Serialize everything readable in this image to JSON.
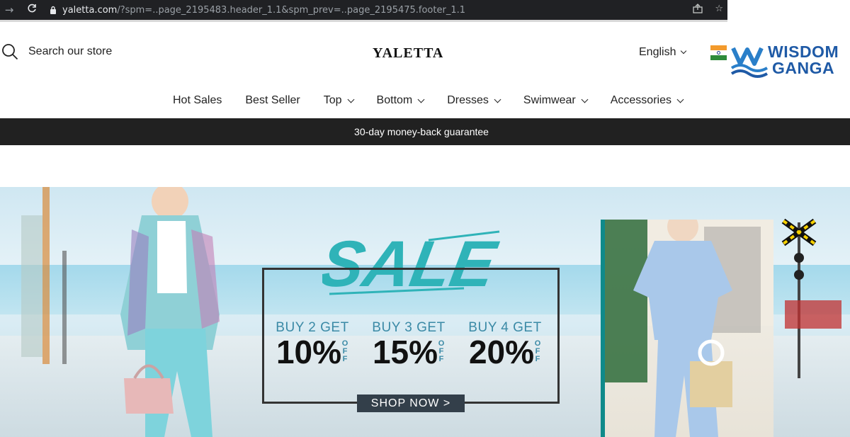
{
  "browser": {
    "url_host": "yaletta.com",
    "url_rest": "/?spm=..page_2195483.header_1.1&spm_prev=..page_2195475.footer_1.1"
  },
  "header": {
    "search_placeholder": "Search our store",
    "logo": "YALETTA",
    "language": "English"
  },
  "menu": [
    {
      "label": "Hot Sales",
      "has_dropdown": false
    },
    {
      "label": "Best Seller",
      "has_dropdown": false
    },
    {
      "label": "Top",
      "has_dropdown": true
    },
    {
      "label": "Bottom",
      "has_dropdown": true
    },
    {
      "label": "Dresses",
      "has_dropdown": true
    },
    {
      "label": "Swimwear",
      "has_dropdown": true
    },
    {
      "label": "Accessories",
      "has_dropdown": true
    }
  ],
  "announcement": "30-day money-back guarantee",
  "banner": {
    "sale_word": "SALE",
    "offers": [
      {
        "top": "BUY 2 GET",
        "pct": "10%",
        "off": [
          "O",
          "F",
          "F"
        ]
      },
      {
        "top": "BUY 3 GET",
        "pct": "15%",
        "off": [
          "O",
          "F",
          "F"
        ]
      },
      {
        "top": "BUY 4 GET",
        "pct": "20%",
        "off": [
          "O",
          "F",
          "F"
        ]
      }
    ],
    "cta": "SHOP NOW >"
  },
  "watermark": {
    "line1": "WISDOM",
    "line2": "GANGA"
  },
  "colors": {
    "browser_bar": "#202124",
    "announce_bar": "#212121",
    "sale_accent": "#2fb3b8",
    "cta_bg": "#333f4a",
    "watermark": "#1f5aa6"
  }
}
